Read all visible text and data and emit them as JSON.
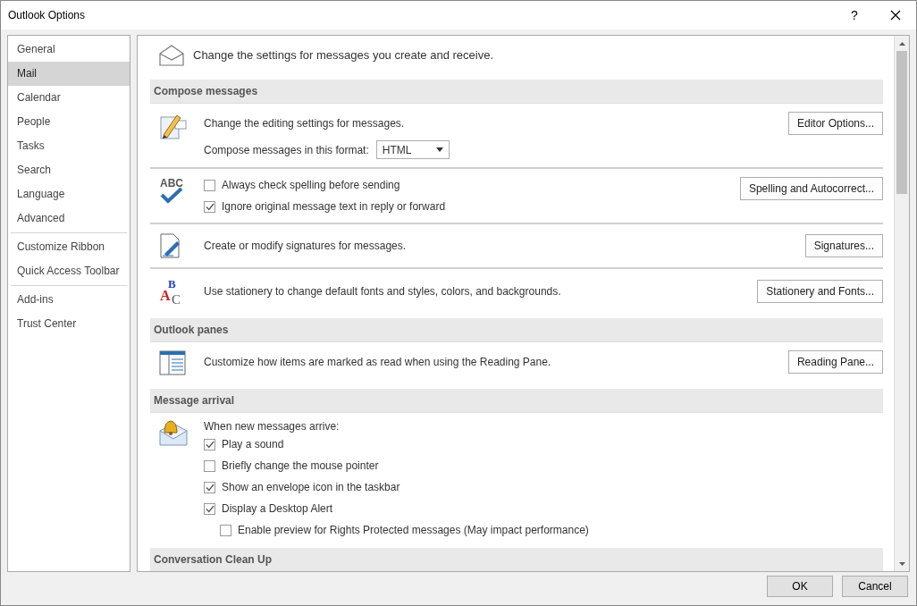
{
  "window": {
    "title": "Outlook Options",
    "help": "?"
  },
  "sidebar": {
    "groups": [
      [
        {
          "label": "General",
          "selected": false
        },
        {
          "label": "Mail",
          "selected": true
        },
        {
          "label": "Calendar",
          "selected": false
        },
        {
          "label": "People",
          "selected": false
        },
        {
          "label": "Tasks",
          "selected": false
        },
        {
          "label": "Search",
          "selected": false
        },
        {
          "label": "Language",
          "selected": false
        },
        {
          "label": "Advanced",
          "selected": false
        }
      ],
      [
        {
          "label": "Customize Ribbon",
          "selected": false
        },
        {
          "label": "Quick Access Toolbar",
          "selected": false
        }
      ],
      [
        {
          "label": "Add-ins",
          "selected": false
        },
        {
          "label": "Trust Center",
          "selected": false
        }
      ]
    ]
  },
  "intro": "Change the settings for messages you create and receive.",
  "sections": [
    {
      "heading": "Compose messages",
      "blocks": [
        {
          "kind": "editor",
          "text": "Change the editing settings for messages.",
          "button": "Editor Options...",
          "format_label": "Compose messages in this format:",
          "format_value": "HTML"
        },
        {
          "kind": "spelling",
          "icon_label": "ABC",
          "button": "Spelling and Autocorrect...",
          "checks": [
            {
              "label": "Always check spelling before sending",
              "checked": false
            },
            {
              "label": "Ignore original message text in reply or forward",
              "checked": true
            }
          ]
        },
        {
          "kind": "signatures",
          "text": "Create or modify signatures for messages.",
          "button": "Signatures..."
        },
        {
          "kind": "stationery",
          "icon_letters": [
            "B",
            "A",
            "C"
          ],
          "text": "Use stationery to change default fonts and styles, colors, and backgrounds.",
          "button": "Stationery and Fonts..."
        }
      ]
    },
    {
      "heading": "Outlook panes",
      "blocks": [
        {
          "kind": "reading",
          "text": "Customize how items are marked as read when using the Reading Pane.",
          "button": "Reading Pane..."
        }
      ]
    },
    {
      "heading": "Message arrival",
      "blocks": [
        {
          "kind": "arrival",
          "text": "When new messages arrive:",
          "checks": [
            {
              "label": "Play a sound",
              "checked": true
            },
            {
              "label": "Briefly change the mouse pointer",
              "checked": false
            },
            {
              "label": "Show an envelope icon in the taskbar",
              "checked": true
            },
            {
              "label": "Display a Desktop Alert",
              "checked": true,
              "children": [
                {
                  "label": "Enable preview for Rights Protected messages (May impact performance)",
                  "checked": false
                }
              ]
            }
          ]
        }
      ]
    },
    {
      "heading": "Conversation Clean Up"
    }
  ],
  "footer": {
    "buttons": [
      "OK",
      "Cancel"
    ]
  }
}
